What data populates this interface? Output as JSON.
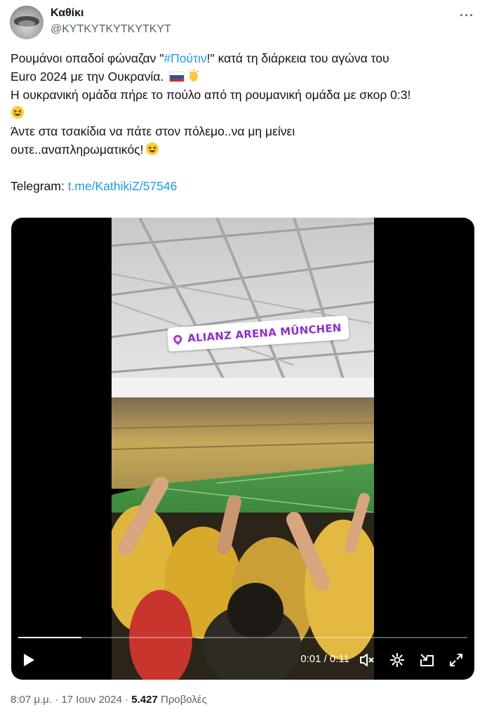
{
  "tweet": {
    "author_name": "Καθίκι",
    "author_handle": "@KYTKYTKYTKYTKYT",
    "lines": [
      [
        "Ρουμάνοι οπαδοί φώναζαν \"",
        "#Πούτιν",
        "!\" κατά τη διάρκεια του αγώνα του"
      ],
      "Euro 2024 με την Ουκρανία.",
      "Η ουκρανική ομάδα πήρε το πούλο από τη ρουμανική ομάδα με σκορ 0:3!",
      "",
      "Άντε στα τσακίδια να πάτε στον πόλεμο..να μη μείνει",
      "ουτε..αναπληρωματικός!"
    ],
    "text_part1": "Ρουμάνοι οπαδοί φώναζαν \"",
    "hashtag": "#Πούτιν",
    "text_part2": "!\" κατά τη διάρκεια του αγώνα του",
    "text_line2": "Euro 2024 με την Ουκρανία.",
    "text_line3": "Η ουκρανική ομάδα πήρε το πούλο από τη ρουμανική ομάδα με σκορ 0:3!",
    "text_line5": "Άντε στα τσακίδια να πάτε στον πόλεμο..να μη μείνει",
    "text_line6": "ουτε..αναπληρωματικός!",
    "telegram_label": "Telegram: ",
    "telegram_link": "t.me/KathikiZ/57546"
  },
  "video": {
    "location_sticker": "ALIANZ ARENA MÜNCHEN",
    "time_display": "0:01 / 0:11",
    "progress": 0.14
  },
  "footer": {
    "time": "8:07 μ.μ.",
    "date": "17 Ιουν 2024",
    "views_count": "5.427",
    "views_label": "Προβολές"
  },
  "colors": {
    "accent": "#1d9bf0",
    "text": "#0f1419",
    "muted": "#536471",
    "sticker_text": "#8d2fd0"
  }
}
